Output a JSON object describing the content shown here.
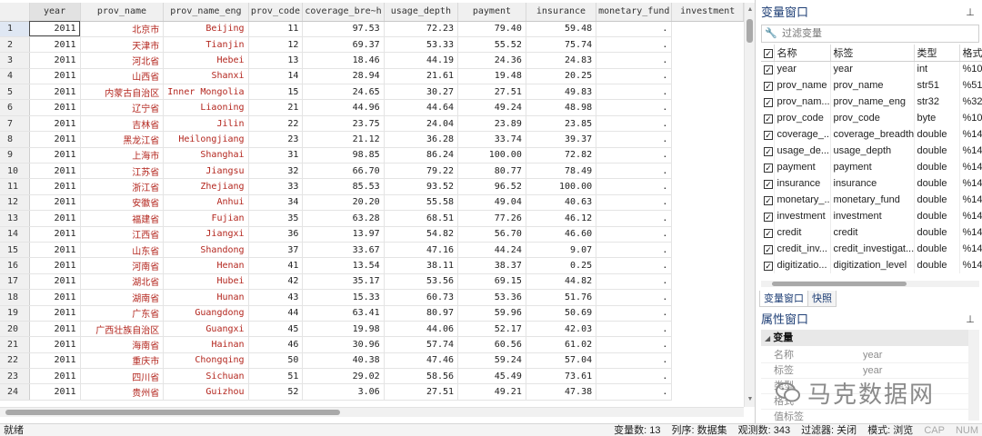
{
  "grid": {
    "columns": [
      "year",
      "prov_name",
      "prov_name_eng",
      "prov_code",
      "coverage_bre~h",
      "usage_depth",
      "payment",
      "insurance",
      "monetary_fund",
      "investment"
    ],
    "rows": [
      [
        "1",
        "2011",
        "北京市",
        "Beijing",
        "11",
        "97.53",
        "72.23",
        "79.40",
        "59.48",
        "."
      ],
      [
        "2",
        "2011",
        "天津市",
        "Tianjin",
        "12",
        "69.37",
        "53.33",
        "55.52",
        "75.74",
        "."
      ],
      [
        "3",
        "2011",
        "河北省",
        "Hebei",
        "13",
        "18.46",
        "44.19",
        "24.36",
        "24.83",
        "."
      ],
      [
        "4",
        "2011",
        "山西省",
        "Shanxi",
        "14",
        "28.94",
        "21.61",
        "19.48",
        "20.25",
        "."
      ],
      [
        "5",
        "2011",
        "内蒙古自治区",
        "Inner Mongolia",
        "15",
        "24.65",
        "30.27",
        "27.51",
        "49.83",
        "."
      ],
      [
        "6",
        "2011",
        "辽宁省",
        "Liaoning",
        "21",
        "44.96",
        "44.64",
        "49.24",
        "48.98",
        "."
      ],
      [
        "7",
        "2011",
        "吉林省",
        "Jilin",
        "22",
        "23.75",
        "24.04",
        "23.89",
        "23.85",
        "."
      ],
      [
        "8",
        "2011",
        "黑龙江省",
        "Heilongjiang",
        "23",
        "21.12",
        "36.28",
        "33.74",
        "39.37",
        "."
      ],
      [
        "9",
        "2011",
        "上海市",
        "Shanghai",
        "31",
        "98.85",
        "86.24",
        "100.00",
        "72.82",
        "."
      ],
      [
        "10",
        "2011",
        "江苏省",
        "Jiangsu",
        "32",
        "66.70",
        "79.22",
        "80.77",
        "78.49",
        "."
      ],
      [
        "11",
        "2011",
        "浙江省",
        "Zhejiang",
        "33",
        "85.53",
        "93.52",
        "96.52",
        "100.00",
        "."
      ],
      [
        "12",
        "2011",
        "安徽省",
        "Anhui",
        "34",
        "20.20",
        "55.58",
        "49.04",
        "40.63",
        "."
      ],
      [
        "13",
        "2011",
        "福建省",
        "Fujian",
        "35",
        "63.28",
        "68.51",
        "77.26",
        "46.12",
        "."
      ],
      [
        "14",
        "2011",
        "江西省",
        "Jiangxi",
        "36",
        "13.97",
        "54.82",
        "56.70",
        "46.60",
        "."
      ],
      [
        "15",
        "2011",
        "山东省",
        "Shandong",
        "37",
        "33.67",
        "47.16",
        "44.24",
        "9.07",
        "."
      ],
      [
        "16",
        "2011",
        "河南省",
        "Henan",
        "41",
        "13.54",
        "38.11",
        "38.37",
        "0.25",
        "."
      ],
      [
        "17",
        "2011",
        "湖北省",
        "Hubei",
        "42",
        "35.17",
        "53.56",
        "69.15",
        "44.82",
        "."
      ],
      [
        "18",
        "2011",
        "湖南省",
        "Hunan",
        "43",
        "15.33",
        "60.73",
        "53.36",
        "51.76",
        "."
      ],
      [
        "19",
        "2011",
        "广东省",
        "Guangdong",
        "44",
        "63.41",
        "80.97",
        "59.96",
        "50.69",
        "."
      ],
      [
        "20",
        "2011",
        "广西壮族自治区",
        "Guangxi",
        "45",
        "19.98",
        "44.06",
        "52.17",
        "42.03",
        "."
      ],
      [
        "21",
        "2011",
        "海南省",
        "Hainan",
        "46",
        "30.96",
        "57.74",
        "60.56",
        "61.02",
        "."
      ],
      [
        "22",
        "2011",
        "重庆市",
        "Chongqing",
        "50",
        "40.38",
        "47.46",
        "59.24",
        "57.04",
        "."
      ],
      [
        "23",
        "2011",
        "四川省",
        "Sichuan",
        "51",
        "29.02",
        "58.56",
        "45.49",
        "73.61",
        "."
      ],
      [
        "24",
        "2011",
        "贵州省",
        "Guizhou",
        "52",
        "3.06",
        "27.51",
        "49.21",
        "47.38",
        "."
      ]
    ]
  },
  "variables_pane": {
    "title": "变量窗口",
    "filter_placeholder": "过滤变量",
    "headers": [
      "名称",
      "标签",
      "类型",
      "格式"
    ],
    "rows": [
      [
        "year",
        "year",
        "int",
        "%10"
      ],
      [
        "prov_name",
        "prov_name",
        "str51",
        "%51"
      ],
      [
        "prov_nam...",
        "prov_name_eng",
        "str32",
        "%32"
      ],
      [
        "prov_code",
        "prov_code",
        "byte",
        "%10"
      ],
      [
        "coverage_...",
        "coverage_breadth",
        "double",
        "%14"
      ],
      [
        "usage_de...",
        "usage_depth",
        "double",
        "%14"
      ],
      [
        "payment",
        "payment",
        "double",
        "%14"
      ],
      [
        "insurance",
        "insurance",
        "double",
        "%14"
      ],
      [
        "monetary_...",
        "monetary_fund",
        "double",
        "%14"
      ],
      [
        "investment",
        "investment",
        "double",
        "%14"
      ],
      [
        "credit",
        "credit",
        "double",
        "%14"
      ],
      [
        "credit_inv...",
        "credit_investigat...",
        "double",
        "%14"
      ],
      [
        "digitizatio...",
        "digitization_level",
        "double",
        "%14"
      ]
    ]
  },
  "tabs": [
    "变量窗口",
    "快照"
  ],
  "properties_pane": {
    "title": "属性窗口",
    "section": "变量",
    "rows": [
      {
        "key": "名称",
        "value": "year"
      },
      {
        "key": "标签",
        "value": "year"
      },
      {
        "key": "类型",
        "value": ""
      },
      {
        "key": "格式",
        "value": ""
      },
      {
        "key": "值标签",
        "value": ""
      }
    ]
  },
  "watermark": "马克数据网",
  "status": {
    "left": "就绪",
    "vars": "变量数: 13",
    "order": "列序: 数据集",
    "obs": "观测数: 343",
    "filter": "过滤器: 关闭",
    "mode": "模式: 浏览",
    "cap": "CAP",
    "num": "NUM"
  }
}
